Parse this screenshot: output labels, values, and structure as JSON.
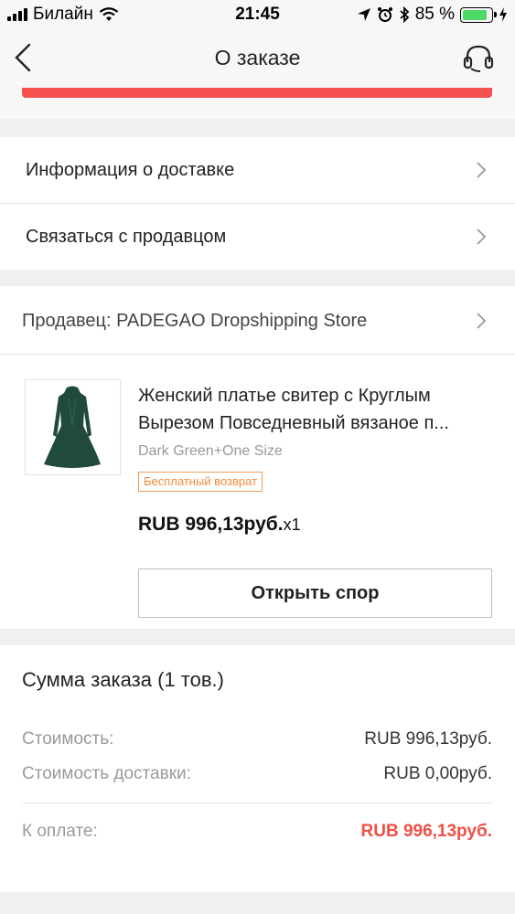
{
  "status_bar": {
    "carrier": "Билайн",
    "time": "21:45",
    "battery": "85 %"
  },
  "nav": {
    "title": "О заказе",
    "back_icon": "chevron-left-icon",
    "support_icon": "headset-icon"
  },
  "menu": {
    "delivery_info": "Информация о доставке",
    "contact_seller": "Связаться с продавцом"
  },
  "seller": {
    "label": "Продавец: PADEGAO Dropshipping Store"
  },
  "product": {
    "title": "Женский платье свитер с Круглым Вырезом Повседневный  вязаное п...",
    "variant": "Dark Green+One Size",
    "badge": "Бесплатный возврат",
    "price": "RUB 996,13руб.",
    "quantity": "x1",
    "image_color": "#1f4a3c"
  },
  "dispute": {
    "button_label": "Открыть спор"
  },
  "summary": {
    "title": "Сумма заказа (1 тов.)",
    "cost_label": "Стоимость:",
    "cost_value": "RUB 996,13руб.",
    "shipping_label": "Стоимость доставки:",
    "shipping_value": "RUB 0,00руб.",
    "total_label": "К оплате:",
    "total_value": "RUB 996,13руб."
  },
  "colors": {
    "accent_red": "#f04f45",
    "badge_orange": "#f08a3b",
    "battery_green": "#4cd964"
  }
}
